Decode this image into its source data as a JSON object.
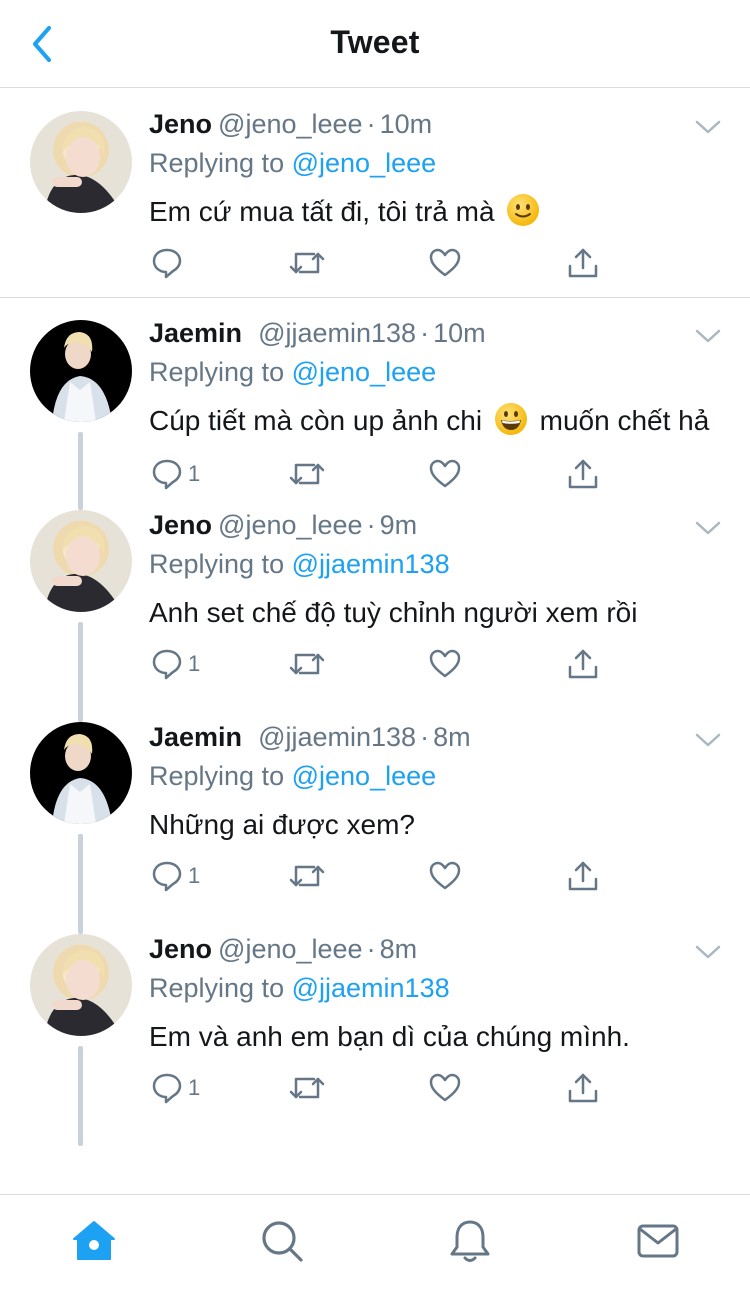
{
  "header": {
    "title": "Tweet"
  },
  "reply_prefix": "Replying to",
  "tweets": [
    {
      "name": "Jeno",
      "handle": "@jeno_leee",
      "time": "10m",
      "replying_to": "@jeno_leee",
      "text": "Em cứ mua tất đi, tôi trả mà",
      "emoji": "slightly-smiling-face",
      "reply_count": ""
    },
    {
      "name": "Jaemin",
      "handle": "@jjaemin138",
      "time": "10m",
      "replying_to": "@jeno_leee",
      "text_before": "Cúp tiết mà còn up ảnh chi",
      "emoji": "grinning-face",
      "text_after": "muốn chết hả",
      "reply_count": "1"
    },
    {
      "name": "Jeno",
      "handle": "@jeno_leee",
      "time": "9m",
      "replying_to": "@jjaemin138",
      "text": "Anh set chế độ tuỳ chỉnh người xem rồi",
      "reply_count": "1"
    },
    {
      "name": "Jaemin",
      "handle": "@jjaemin138",
      "time": "8m",
      "replying_to": "@jeno_leee",
      "text": "Những ai được xem?",
      "reply_count": "1"
    },
    {
      "name": "Jeno",
      "handle": "@jeno_leee",
      "time": "8m",
      "replying_to": "@jjaemin138",
      "text": "Em và anh em bạn dì của chúng mình.",
      "reply_count": "1"
    }
  ],
  "tabs": [
    "home",
    "search",
    "notifications",
    "messages"
  ],
  "colors": {
    "accent": "#1da1f2",
    "muted": "#657786",
    "text": "#14171a",
    "divider": "#d9dde1",
    "thread": "#c9d2da"
  }
}
